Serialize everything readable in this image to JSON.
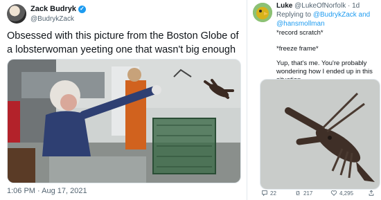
{
  "left_tweet": {
    "author_name": "Zack Budryk",
    "handle": "@BudrykZack",
    "text": "Obsessed with this picture from the Boston Globe of a lobsterwoman yeeting one that wasn't big enough",
    "timestamp": "1:06 PM · Aug 17, 2021"
  },
  "right_tweet": {
    "author_name": "Luke",
    "handle_and_time": "@LukeOfNorfolk · 1d",
    "replying_label": "Replying to",
    "replying_users": "@BudrykZack and @hansmollman",
    "lines": [
      "*record scratch*",
      "*freeze frame*",
      "Yup, that's me. You're probably wondering how I ended up in this situation"
    ],
    "actions": {
      "replies": "22",
      "retweets": "217",
      "likes": "4,295"
    }
  },
  "colors": {
    "accent": "#1d9bf0",
    "muted": "#536471",
    "divider": "#e1e8ed"
  },
  "icons": [
    "verified-badge-icon",
    "reply-icon",
    "retweet-icon",
    "like-icon",
    "share-icon"
  ]
}
